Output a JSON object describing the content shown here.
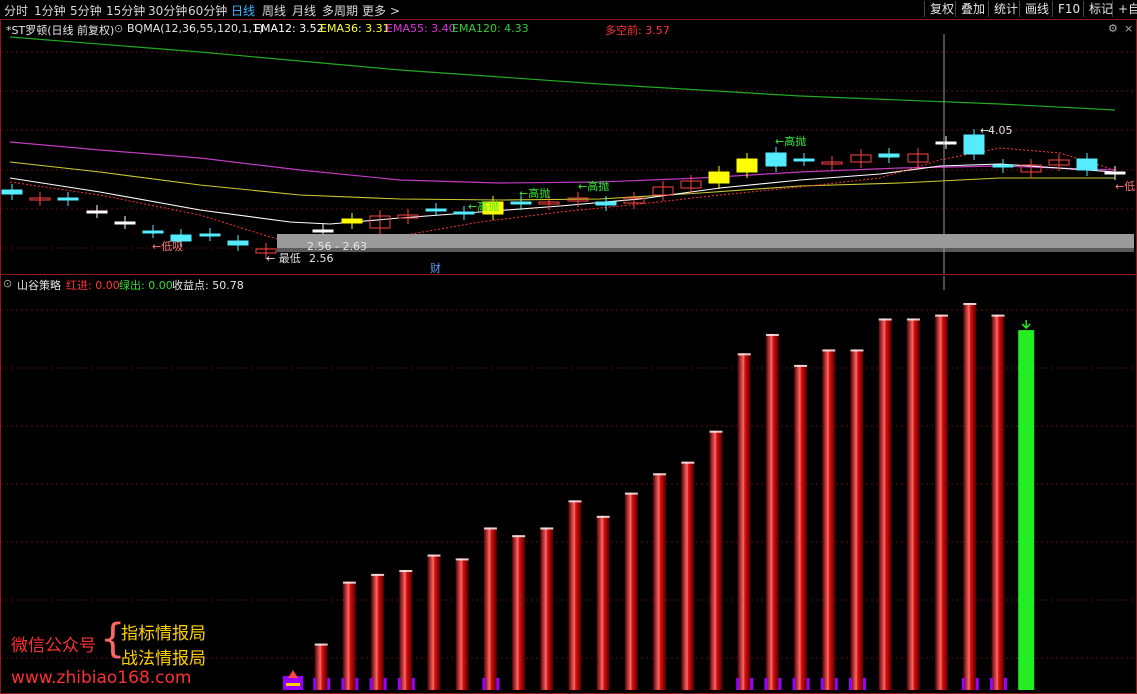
{
  "toolbar": {
    "tabs": [
      "分时",
      "1分钟",
      "5分钟",
      "15分钟",
      "30分钟",
      "60分钟",
      "日线",
      "周线",
      "月线",
      "多周期",
      "更多 >"
    ],
    "active_tab": "日线",
    "buttons": [
      "复权",
      "叠加",
      "统计",
      "画线",
      "F10",
      "标记",
      "+自"
    ]
  },
  "main_header": {
    "stock": "*ST罗顿(日线 前复权)",
    "indicator": "BQMA(12,36,55,120,1,1)",
    "ema12": "EMA12: 3.52",
    "ema36": "EMA36: 3.31",
    "ema55": "EMA55: 3.40",
    "ema120": "EMA120: 4.33",
    "bull_bear": "多空前: 3.57",
    "colors": {
      "ema12": "#ffffff",
      "ema36": "#ffff33",
      "ema55": "#dd33dd",
      "ema120": "#33cc33",
      "bull_bear": "#ff3333"
    }
  },
  "price_labels": {
    "high_label": "4.05",
    "range_label": "2.56 - 2.63",
    "low_label": "2.56",
    "low_prefix": "← 最低",
    "fin_marker": "财",
    "signals": [
      {
        "text": "←高抛",
        "kind": "sell"
      },
      {
        "text": "←高抛",
        "kind": "sell"
      },
      {
        "text": "←高抛",
        "kind": "sell"
      },
      {
        "text": "←高抛",
        "kind": "sell"
      },
      {
        "text": "←低吸",
        "kind": "buy"
      },
      {
        "text": "←低",
        "kind": "buy"
      }
    ]
  },
  "sub_header": {
    "name": "山谷策略",
    "red_in": "红进: 0.00",
    "green_out": "绿出: 0.00",
    "profit": "收益点: 50.78"
  },
  "watermark": {
    "label": "微信公众号",
    "line1": "指标情报局",
    "line2": "战法情报局",
    "url": "www.zhibiao168.com"
  },
  "chart_data": {
    "type": "bar",
    "title": "",
    "indicator": "山谷策略",
    "values": [
      0,
      12,
      28,
      30,
      31,
      35,
      34,
      42,
      40,
      42,
      49,
      45,
      51,
      56,
      59,
      67,
      87,
      92,
      84,
      88,
      88,
      96,
      96,
      97,
      100,
      97,
      93
    ],
    "colors": [
      "purple",
      "red",
      "red",
      "red",
      "red",
      "red",
      "red",
      "red",
      "red",
      "red",
      "red",
      "red",
      "red",
      "red",
      "red",
      "red",
      "red",
      "red",
      "red",
      "red",
      "red",
      "red",
      "red",
      "red",
      "red",
      "red",
      "green"
    ],
    "ylim": [
      0,
      100
    ],
    "purple_ticks": [
      true,
      true,
      true,
      true,
      true,
      false,
      false,
      true,
      false,
      false,
      false,
      false,
      false,
      false,
      false,
      false,
      true,
      true,
      true,
      true,
      true,
      false,
      false,
      false,
      true,
      true,
      false
    ]
  }
}
